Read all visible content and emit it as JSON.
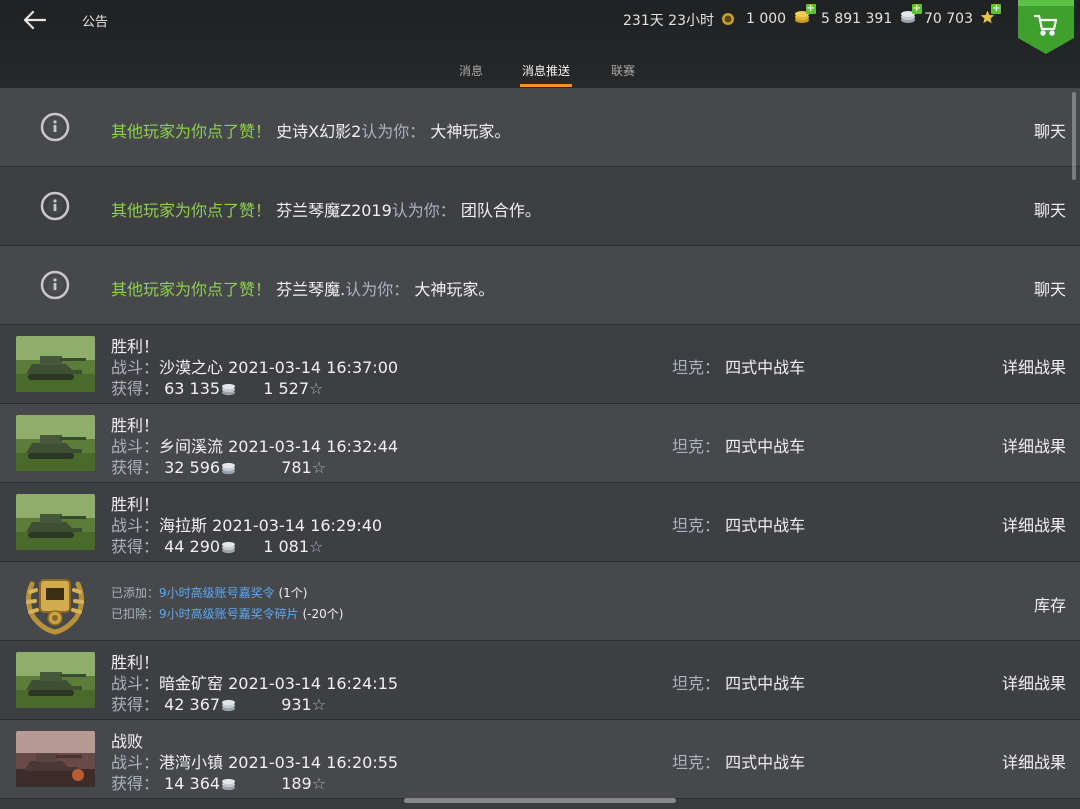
{
  "header": {
    "title": "公告",
    "premium_time": "231天 23小时",
    "gold": "1 000",
    "silver": "5 891 391",
    "free_xp": "70 703"
  },
  "tabs": [
    {
      "label": "消息",
      "active": false
    },
    {
      "label": "消息推送",
      "active": true
    },
    {
      "label": "联赛",
      "active": false
    }
  ],
  "likes": [
    {
      "prefix": "其他玩家为你点了赞！",
      "player": "史诗X幻影2",
      "verb": "认为你：",
      "trait": "大神玩家。",
      "action": "聊天"
    },
    {
      "prefix": "其他玩家为你点了赞！",
      "player": "芬兰琴魔Z2019",
      "verb": "认为你：",
      "trait": "团队合作。",
      "action": "聊天"
    },
    {
      "prefix": "其他玩家为你点了赞！",
      "player": "芬兰琴魔.",
      "verb": "认为你：",
      "trait": "大神玩家。",
      "action": "聊天"
    }
  ],
  "battles": [
    {
      "result": "胜利！",
      "battle_label": "战斗：",
      "map": "沙漠之心",
      "time": "2021-03-14 16:37:00",
      "earn_label": "获得：",
      "credits": "63 135",
      "xp": "1 527",
      "tank_label": "坦克：",
      "tank": "四式中战车",
      "action": "详细战果"
    },
    {
      "result": "胜利！",
      "battle_label": "战斗：",
      "map": "乡间溪流",
      "time": "2021-03-14 16:32:44",
      "earn_label": "获得：",
      "credits": "32 596",
      "xp": "781",
      "tank_label": "坦克：",
      "tank": "四式中战车",
      "action": "详细战果"
    },
    {
      "result": "胜利！",
      "battle_label": "战斗：",
      "map": "海拉斯",
      "time": "2021-03-14 16:29:40",
      "earn_label": "获得：",
      "credits": "44 290",
      "xp": "1 081",
      "tank_label": "坦克：",
      "tank": "四式中战车",
      "action": "详细战果"
    },
    {
      "result": "胜利！",
      "battle_label": "战斗：",
      "map": "暗金矿窑",
      "time": "2021-03-14 16:24:15",
      "earn_label": "获得：",
      "credits": "42 367",
      "xp": "931",
      "tank_label": "坦克：",
      "tank": "四式中战车",
      "action": "详细战果"
    },
    {
      "result": "战败",
      "battle_label": "战斗：",
      "map": "港湾小镇",
      "time": "2021-03-14 16:20:55",
      "earn_label": "获得：",
      "credits": "14 364",
      "xp": "189",
      "tank_label": "坦克：",
      "tank": "四式中战车",
      "action": "详细战果"
    }
  ],
  "reward": {
    "added_label": "已添加：",
    "added_item": "9小时高级账号嘉奖令",
    "added_count": "(1个)",
    "removed_label": "已扣除：",
    "removed_item": "9小时高级账号嘉奖令碎片",
    "removed_count": "(-20个)",
    "action": "库存"
  },
  "colors": {
    "accent": "#f0921e",
    "like_green": "#8fd04a",
    "link_blue": "#5ea9f2",
    "shop_green": "#3fa02e"
  }
}
